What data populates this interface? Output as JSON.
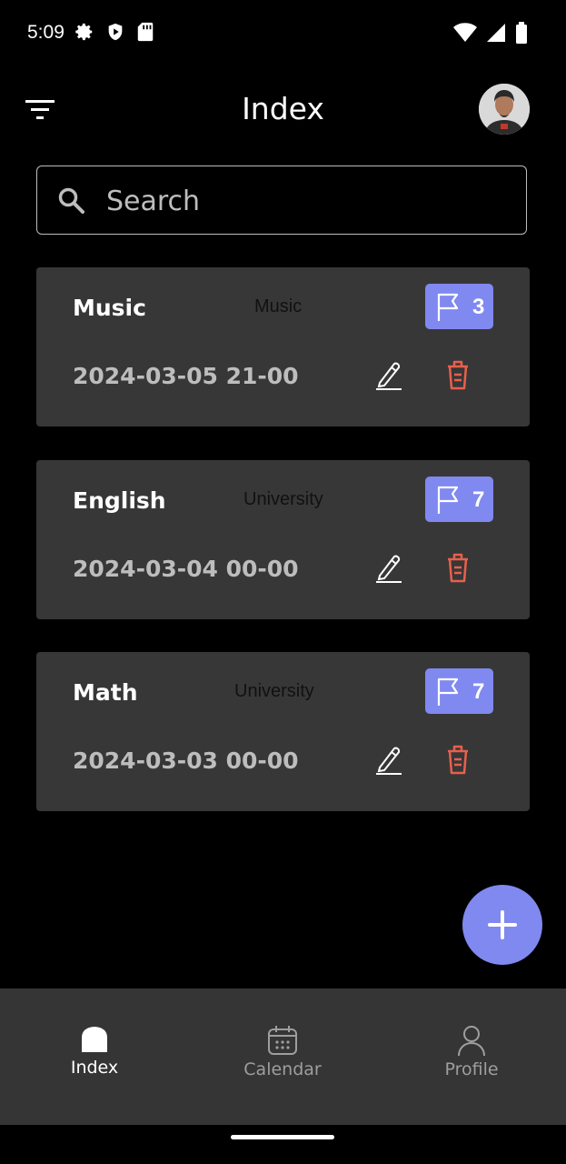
{
  "status_bar": {
    "time": "5:09",
    "left_icons": [
      "gear-icon",
      "shield-icon",
      "sd-card-icon"
    ],
    "right_icons": [
      "wifi-icon",
      "signal-icon",
      "battery-icon"
    ]
  },
  "header": {
    "title": "Index",
    "filter_icon": "filter-icon",
    "avatar": "avatar"
  },
  "search": {
    "placeholder": "Search",
    "value": ""
  },
  "tasks": [
    {
      "title": "Music",
      "category": "Music",
      "priority": "3",
      "date": "2024-03-05 21-00"
    },
    {
      "title": "English",
      "category": "University",
      "priority": "7",
      "date": "2024-03-04 00-00"
    },
    {
      "title": "Math",
      "category": "University",
      "priority": "7",
      "date": "2024-03-03 00-00"
    }
  ],
  "fab": {
    "icon": "plus-icon"
  },
  "bottom_nav": {
    "items": [
      {
        "label": "Index",
        "icon": "home-icon",
        "active": true
      },
      {
        "label": "Calendar",
        "icon": "calendar-icon",
        "active": false
      },
      {
        "label": "Profile",
        "icon": "person-icon",
        "active": false
      }
    ]
  },
  "colors": {
    "background": "#000000",
    "card": "#373737",
    "accent": "#8089ef",
    "delete": "#e8604c",
    "nav_background": "#353535"
  }
}
